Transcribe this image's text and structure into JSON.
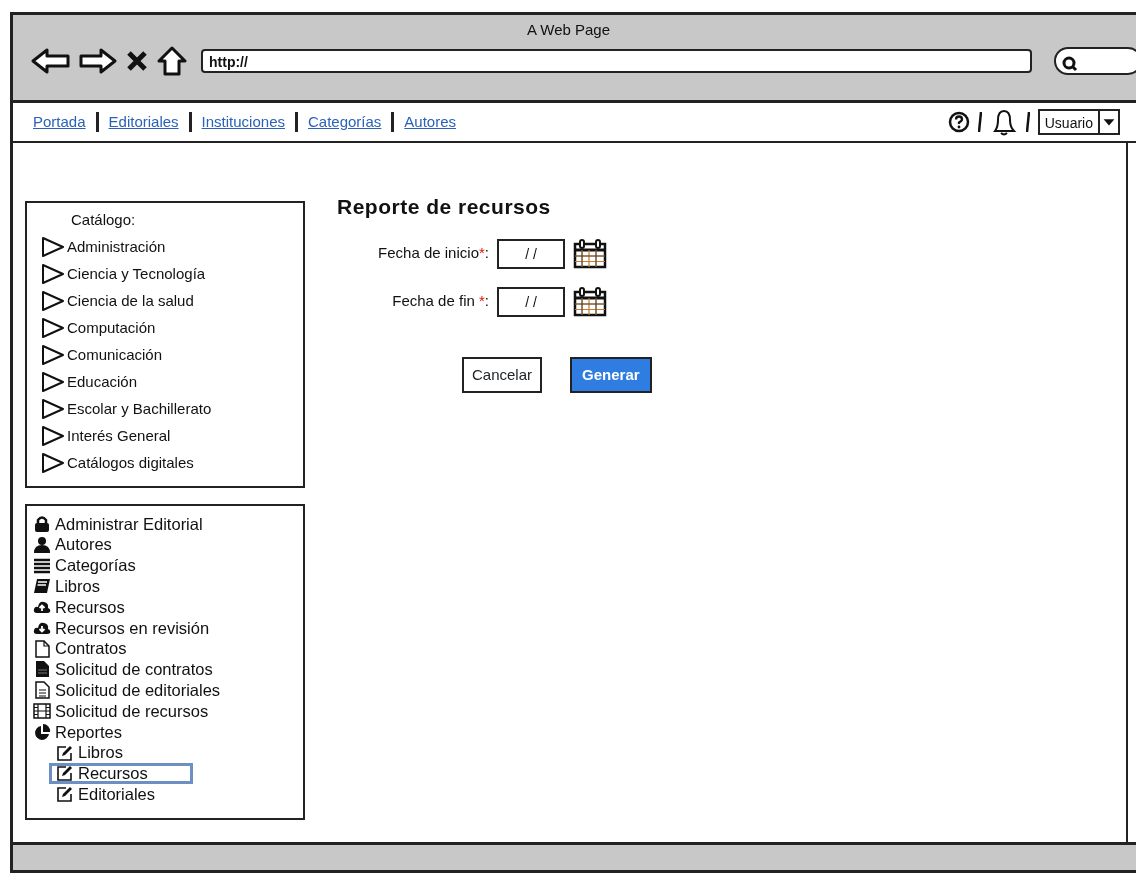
{
  "window": {
    "title": "A Web Page"
  },
  "browser": {
    "url": "http://"
  },
  "nav": {
    "links": [
      {
        "label": "Portada"
      },
      {
        "label": "Editoriales"
      },
      {
        "label": "Instituciones"
      },
      {
        "label": "Categorías"
      },
      {
        "label": "Autores"
      }
    ],
    "user_menu": "Usuario"
  },
  "catalog": {
    "title": "Catálogo:",
    "items": [
      {
        "label": "Administración"
      },
      {
        "label": "Ciencia y Tecnología"
      },
      {
        "label": "Ciencia de la salud"
      },
      {
        "label": "Computación"
      },
      {
        "label": "Comunicación"
      },
      {
        "label": "Educación"
      },
      {
        "label": "Escolar y Bachillerato"
      },
      {
        "label": "Interés General"
      },
      {
        "label": "Catálogos digitales"
      }
    ]
  },
  "menu": [
    {
      "label": "Administrar Editorial",
      "kind": "lock",
      "selected": false
    },
    {
      "label": "Autores",
      "kind": "user",
      "selected": false
    },
    {
      "label": "Categorías",
      "kind": "list",
      "selected": false
    },
    {
      "label": "Libros",
      "kind": "book",
      "selected": false
    },
    {
      "label": "Recursos",
      "kind": "upload",
      "selected": false
    },
    {
      "label": "Recursos en revisión",
      "kind": "download",
      "selected": false
    },
    {
      "label": "Contratos",
      "kind": "file",
      "selected": false
    },
    {
      "label": "Solicitud de contratos",
      "kind": "filled-file",
      "selected": false
    },
    {
      "label": "Solicitud de editoriales",
      "kind": "text-file",
      "selected": false
    },
    {
      "label": "Solicitud de recursos",
      "kind": "film",
      "selected": false
    },
    {
      "label": "Reportes",
      "kind": "pie",
      "selected": false,
      "children": [
        {
          "label": "Libros",
          "kind": "edit",
          "selected": false
        },
        {
          "label": "Recursos",
          "kind": "edit",
          "selected": true
        },
        {
          "label": "Editoriales",
          "kind": "edit",
          "selected": false
        }
      ]
    }
  ],
  "form": {
    "title": "Reporte de recursos",
    "fields": [
      {
        "label": "Fecha de inicio",
        "mark": "*",
        "suffix": ":",
        "value": "/ /"
      },
      {
        "label": "Fecha de fin ",
        "mark": "*",
        "suffix": ":",
        "value": "/ /"
      }
    ],
    "buttons": [
      {
        "label": "Cancelar",
        "kind": "secondary"
      },
      {
        "label": "Generar",
        "kind": "primary"
      }
    ]
  }
}
